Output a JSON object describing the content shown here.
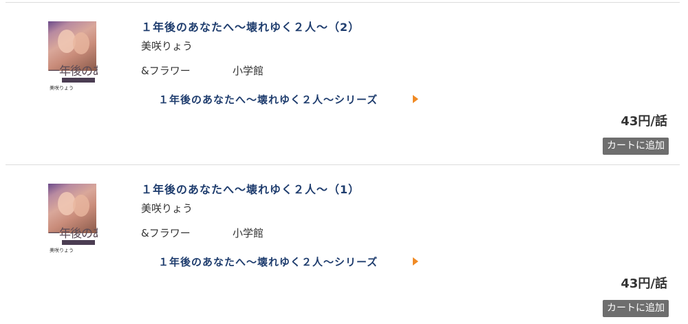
{
  "items": [
    {
      "title": "１年後のあなたへ〜壊れゆく２人〜（2）",
      "author": "美咲りょう",
      "label": "&フラワー",
      "publisher": "小学館",
      "series_link": "１年後のあなたへ〜壊れゆく２人〜シリーズ",
      "price": "43円/話",
      "cart_button": "カートに追加",
      "cover": {
        "title": "一年後のあなたへ",
        "author": "美咲りょう"
      }
    },
    {
      "title": "１年後のあなたへ〜壊れゆく２人〜（1）",
      "author": "美咲りょう",
      "label": "&フラワー",
      "publisher": "小学館",
      "series_link": "１年後のあなたへ〜壊れゆく２人〜シリーズ",
      "price": "43円/話",
      "cart_button": "カートに追加",
      "cover": {
        "title": "一年後のあなたへ",
        "author": "美咲りょう"
      }
    }
  ],
  "colors": {
    "title": "#1f3d6e",
    "arrow": "#f08a24",
    "cart_bg": "#6e6e6e",
    "divider": "#dcdcdc"
  }
}
